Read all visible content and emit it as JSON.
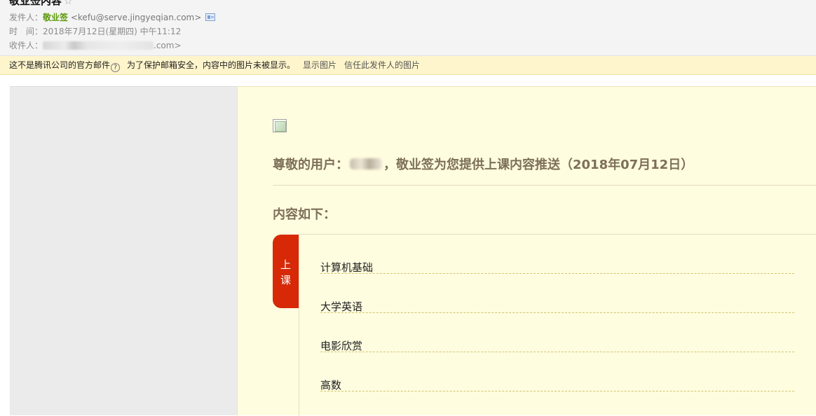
{
  "email": {
    "subject": "敬业签内容",
    "star_icon": "☆",
    "sender_label": "发件人：",
    "sender_name": "敬业签",
    "sender_address": "<kefu@serve.jingyeqian.com>",
    "sender_card_icon": "contact-card-icon",
    "time_label": "时　间：",
    "time_value": "2018年7月12日(星期四) 中午11:12",
    "recipient_label": "收件人：",
    "recipient_suffix": ".com>"
  },
  "warning": {
    "message1": "这不是腾讯公司的官方邮件",
    "help_icon": "?",
    "message2": "为了保护邮箱安全，内容中的图片未被显示。",
    "show_images_link": "显示图片",
    "trust_sender_link": "信任此发件人的图片"
  },
  "body": {
    "greeting_prefix": "尊敬的用户：",
    "greeting_suffix": "，敬业签为您提供上课内容推送（2018年07月12日）",
    "content_heading": "内容如下：",
    "tab_chars": [
      "上",
      "课"
    ],
    "courses": [
      "计算机基础",
      "大学英语",
      "电影欣赏",
      "高数"
    ]
  },
  "colors": {
    "sender_green": "#5a9a0a",
    "warning_bg": "#fff5cc",
    "content_bg": "#fffde0",
    "tab_red": "#d72907",
    "heading_brown": "#7e6f58"
  }
}
